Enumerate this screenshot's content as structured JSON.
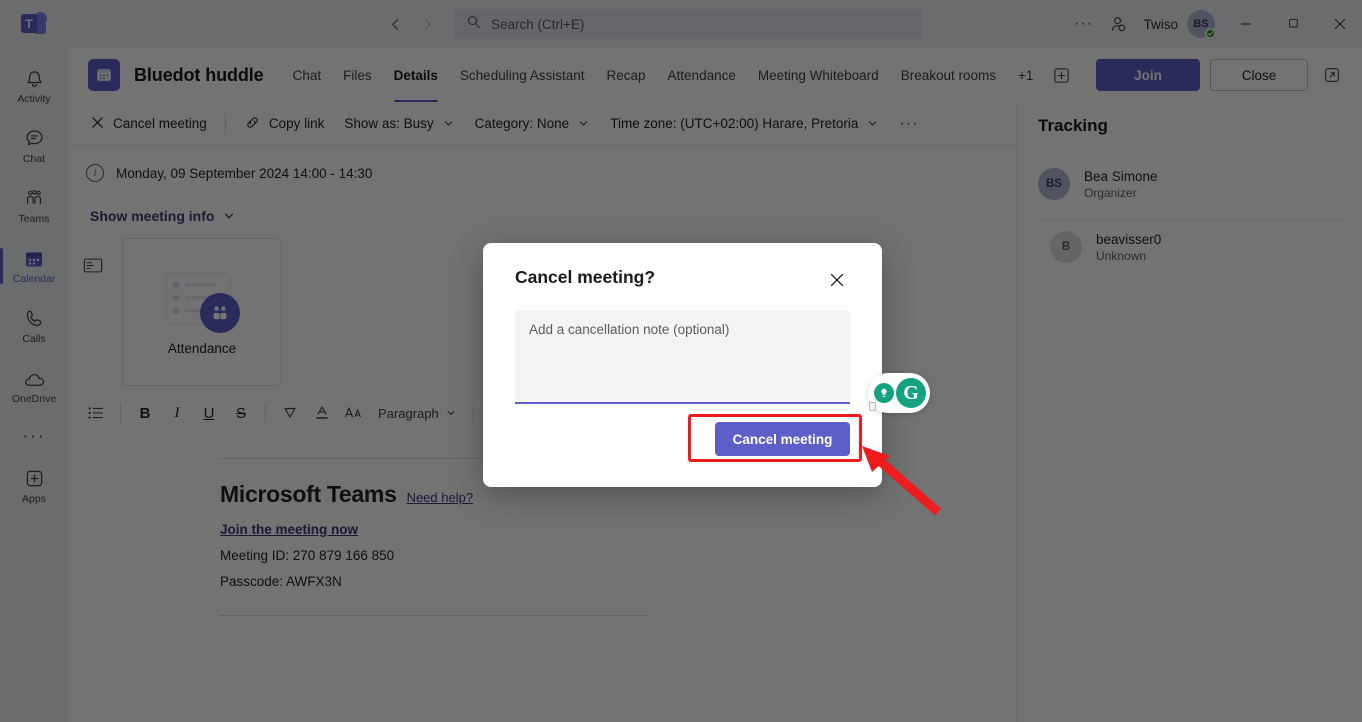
{
  "titlebar": {
    "back_icon": "chevron-left-icon",
    "forward_icon": "chevron-right-icon",
    "search_placeholder": "Search (Ctrl+E)",
    "search_icon": "search-icon",
    "ellipsis": "···",
    "person_icon": "person-add-icon",
    "user_name": "Twiso",
    "avatar_initials": "BS",
    "minimize": "–",
    "maximize": "❐",
    "close": "✕"
  },
  "rail": {
    "items": [
      {
        "label": "Activity",
        "icon": "bell-icon",
        "active": false
      },
      {
        "label": "Chat",
        "icon": "chat-icon",
        "active": false
      },
      {
        "label": "Teams",
        "icon": "teams-icon",
        "active": false
      },
      {
        "label": "Calendar",
        "icon": "calendar-icon",
        "active": true
      },
      {
        "label": "Calls",
        "icon": "phone-icon",
        "active": false
      },
      {
        "label": "OneDrive",
        "icon": "cloud-icon",
        "active": false
      }
    ],
    "more_icon": "more-horizontal-icon",
    "apps_label": "Apps",
    "apps_icon": "apps-plus-icon"
  },
  "meeting": {
    "title": "Bluedot huddle",
    "icon": "calendar-icon",
    "tabs": [
      {
        "label": "Chat",
        "active": false
      },
      {
        "label": "Files",
        "active": false
      },
      {
        "label": "Details",
        "active": true
      },
      {
        "label": "Scheduling Assistant",
        "active": false
      },
      {
        "label": "Recap",
        "active": false
      },
      {
        "label": "Attendance",
        "active": false
      },
      {
        "label": "Meeting Whiteboard",
        "active": false
      },
      {
        "label": "Breakout rooms",
        "active": false
      }
    ],
    "overflow_tabs": "+1",
    "add_tab_icon": "plus-box-icon",
    "join_label": "Join",
    "close_label": "Close",
    "popout_icon": "open-in-new-icon"
  },
  "toolbar": {
    "cancel_meeting": "Cancel meeting",
    "cancel_icon": "close-x-icon",
    "copy_link": "Copy link",
    "copy_link_icon": "link-icon",
    "show_as": "Show as: Busy",
    "category": "Category: None",
    "time_zone": "Time zone: (UTC+02:00) Harare, Pretoria",
    "more_icon": "more-horizontal-icon"
  },
  "details": {
    "date_time": "Monday, 09 September 2024 14:00 - 14:30",
    "info_icon": "info-circle-icon",
    "show_meeting_info": "Show meeting info",
    "note_icon": "note-icon",
    "attendance_card_label": "Attendance",
    "attendance_icon": "people-icon"
  },
  "format_toolbar": {
    "list_icon": "bullet-list-icon",
    "bold": "B",
    "italic": "I",
    "underline": "U",
    "strikethrough": "S",
    "highlight_icon": "highlight-icon",
    "font_color_icon": "font-color-icon",
    "font_size_icon": "font-size-icon",
    "paragraph": "Paragraph",
    "chevron_icon": "chevron-down-icon"
  },
  "invite_body": {
    "heading": "Microsoft Teams",
    "need_help": "Need help?",
    "join_now": "Join the meeting now",
    "meeting_id": "Meeting ID: 270 879 166 850",
    "passcode": "Passcode: AWFX3N"
  },
  "tracking": {
    "title": "Tracking",
    "people": [
      {
        "initials": "BS",
        "name": "Bea Simone",
        "status": "Organizer"
      },
      {
        "initials": "B",
        "name": "beavisser0",
        "status": "Unknown"
      }
    ]
  },
  "modal": {
    "title": "Cancel meeting?",
    "close_icon": "close-x-icon",
    "note_placeholder": "Add a cancellation note (optional)",
    "note_value": "",
    "confirm_label": "Cancel meeting"
  },
  "annotation": {
    "highlight_color": "#ee1c1c",
    "arrow_color": "#ee1c1c"
  },
  "grammarly": {
    "badge_letter": "G",
    "bulb_icon": "lightbulb-icon"
  },
  "colors": {
    "accent": "#5b5fc7",
    "rail_bg": "#eef0f4",
    "link": "#3d3d7a",
    "presence_available": "#13a10e"
  }
}
